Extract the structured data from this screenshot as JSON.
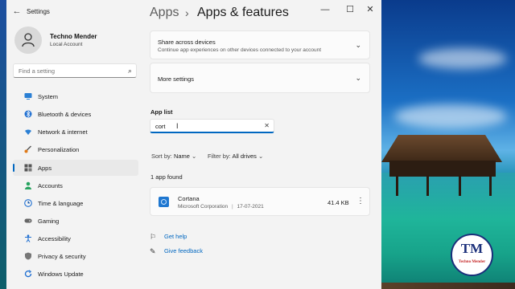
{
  "window": {
    "app_title": "Settings",
    "controls": {
      "minimize": "—",
      "maximize": "☐",
      "close": "✕"
    }
  },
  "profile": {
    "name": "Techno Mender",
    "account": "Local Account"
  },
  "nav_search": {
    "placeholder": "Find a setting"
  },
  "nav": {
    "items": [
      {
        "label": "System",
        "icon": "monitor-icon"
      },
      {
        "label": "Bluetooth & devices",
        "icon": "bluetooth-icon"
      },
      {
        "label": "Network & internet",
        "icon": "wifi-icon"
      },
      {
        "label": "Personalization",
        "icon": "brush-icon"
      },
      {
        "label": "Apps",
        "icon": "apps-icon",
        "active": true
      },
      {
        "label": "Accounts",
        "icon": "person-icon"
      },
      {
        "label": "Time & language",
        "icon": "globe-clock-icon"
      },
      {
        "label": "Gaming",
        "icon": "gamepad-icon"
      },
      {
        "label": "Accessibility",
        "icon": "accessibility-icon"
      },
      {
        "label": "Privacy & security",
        "icon": "shield-icon"
      },
      {
        "label": "Windows Update",
        "icon": "update-icon"
      }
    ]
  },
  "header": {
    "breadcrumb_root": "Apps",
    "separator": "›",
    "title": "Apps & features"
  },
  "share_card": {
    "title": "Share across devices",
    "subtitle": "Continue app experiences on other devices connected to your account"
  },
  "more_settings": {
    "title": "More settings"
  },
  "app_list": {
    "label": "App list",
    "search_value": "cort",
    "sort_label": "Sort by:",
    "sort_value": "Name",
    "filter_label": "Filter by:",
    "filter_value": "All drives",
    "result_count": "1 app found"
  },
  "apps": [
    {
      "name": "Cortana",
      "publisher": "Microsoft Corporation",
      "separator": "|",
      "date": "17-07-2021",
      "size": "41.4 KB"
    }
  ],
  "help": {
    "get_help": "Get help",
    "give_feedback": "Give feedback"
  },
  "watermark": {
    "monogram": "TM",
    "text": "Techno Mender"
  },
  "colors": {
    "accent": "#0067c0",
    "window_bg": "#f3f3f3",
    "card_bg": "#fbfbfb"
  }
}
